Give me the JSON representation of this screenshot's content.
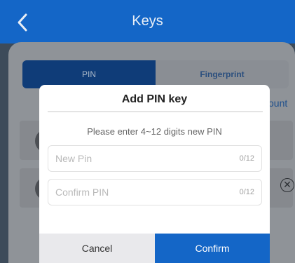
{
  "header": {
    "title": "Keys",
    "back_icon": "chevron-left-icon"
  },
  "tabs": {
    "pin": "PIN",
    "fingerprint": "Fingerprint"
  },
  "background": {
    "count_fragment": "ount"
  },
  "dialog": {
    "title": "Add PIN key",
    "hint": "Please enter 4~12 digits new PIN",
    "new_pin": {
      "placeholder": "New Pin",
      "value": "",
      "counter": "0/12"
    },
    "confirm_pin": {
      "placeholder": "Confirm PIN",
      "value": "",
      "counter": "0/12"
    },
    "cancel_label": "Cancel",
    "confirm_label": "Confirm"
  },
  "colors": {
    "brand_blue": "#1466c7",
    "overlay_dark": "#3d4b5a"
  }
}
